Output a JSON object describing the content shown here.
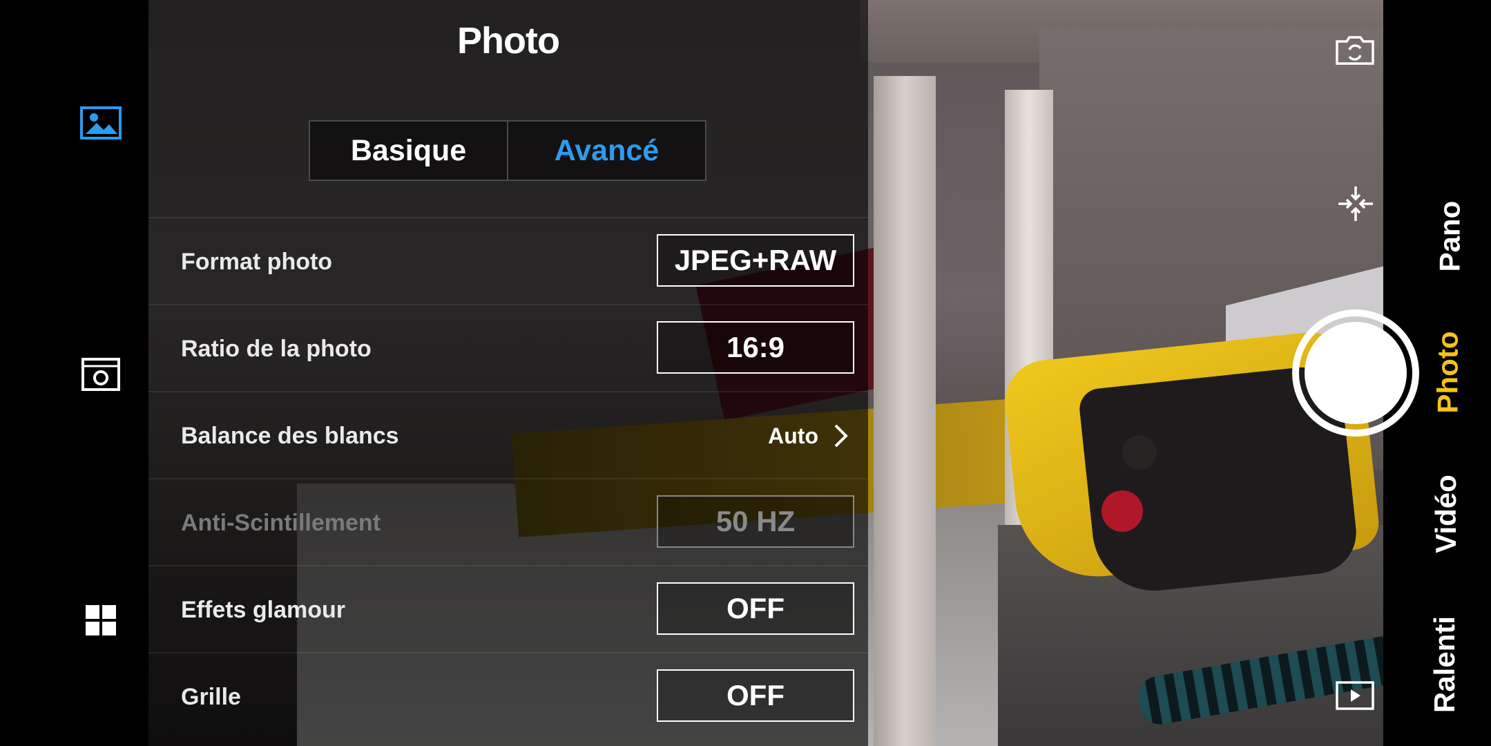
{
  "panel": {
    "title": "Photo",
    "tabs": [
      {
        "label": "Basique",
        "active": false
      },
      {
        "label": "Avancé",
        "active": true
      }
    ],
    "settings": [
      {
        "label": "Format photo",
        "value": "JPEG+RAW",
        "type": "box",
        "enabled": true
      },
      {
        "label": "Ratio de la photo",
        "value": "16:9",
        "type": "box",
        "enabled": true
      },
      {
        "label": "Balance des blancs",
        "value": "Auto",
        "type": "arrow",
        "enabled": true
      },
      {
        "label": "Anti-Scintillement",
        "value": "50 HZ",
        "type": "box",
        "enabled": false
      },
      {
        "label": "Effets glamour",
        "value": "OFF",
        "type": "box",
        "enabled": true
      },
      {
        "label": "Grille",
        "value": "OFF",
        "type": "box",
        "enabled": true
      }
    ]
  },
  "modes": [
    "Pano",
    "Photo",
    "Vidéo",
    "Ralenti"
  ],
  "active_mode": "Photo",
  "icons": {
    "left": [
      "gallery-icon",
      "camera-settings-icon",
      "grid-menu-icon"
    ],
    "right": [
      "switch-camera-icon",
      "focus-icon",
      "shutter-button",
      "playback-icon"
    ]
  },
  "colors": {
    "accent": "#2c9bf0",
    "mode_active": "#f5c21b"
  }
}
